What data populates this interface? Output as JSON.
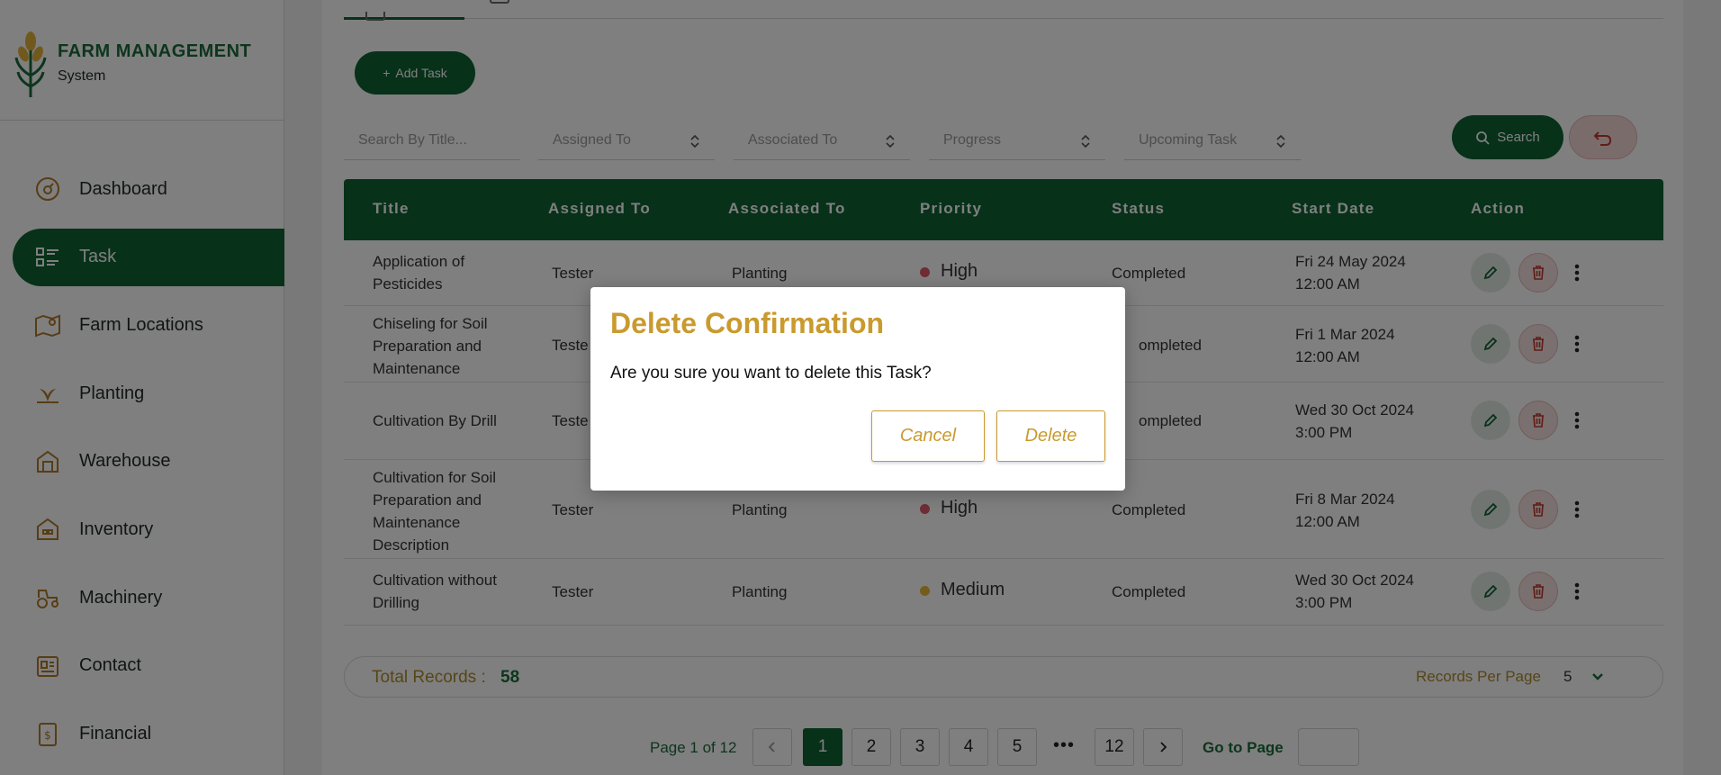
{
  "app": {
    "brand_title": "FARM MANAGEMENT",
    "brand_subtitle": "System"
  },
  "sidebar": {
    "items": [
      {
        "label": "Dashboard",
        "icon": "dashboard-gauge-icon",
        "active": false
      },
      {
        "label": "Task",
        "icon": "task-list-icon",
        "active": true
      },
      {
        "label": "Farm Locations",
        "icon": "map-pin-icon",
        "active": false
      },
      {
        "label": "Planting",
        "icon": "sprout-icon",
        "active": false
      },
      {
        "label": "Warehouse",
        "icon": "warehouse-icon",
        "active": false
      },
      {
        "label": "Inventory",
        "icon": "inventory-icon",
        "active": false
      },
      {
        "label": "Machinery",
        "icon": "tractor-icon",
        "active": false
      },
      {
        "label": "Contact",
        "icon": "contact-card-icon",
        "active": false
      },
      {
        "label": "Financial",
        "icon": "financial-document-icon",
        "active": false
      }
    ]
  },
  "toolbar": {
    "add_label": "Add Task",
    "search_label": "Search"
  },
  "filters": {
    "title_placeholder": "Search By Title...",
    "assigned_to": "Assigned To",
    "associated_to": "Associated To",
    "progress": "Progress",
    "upcoming": "Upcoming Task"
  },
  "table": {
    "headers": [
      "Title",
      "Assigned To",
      "Associated To",
      "Priority",
      "Status",
      "Start Date",
      "Action"
    ],
    "rows": [
      {
        "title": "Application of Pesticides",
        "assigned": "Tester",
        "associated": "Planting",
        "priority": "High",
        "status": "Completed",
        "start": "Fri 24 May 2024 12:00 AM"
      },
      {
        "title": "Chiseling for Soil Preparation and Maintenance",
        "assigned": "Teste",
        "associated": "",
        "priority": "",
        "status": "ompleted",
        "start": "Fri 1 Mar 2024 12:00 AM"
      },
      {
        "title": "Cultivation By Drill",
        "assigned": "Teste",
        "associated": "",
        "priority": "",
        "status": "ompleted",
        "start": "Wed 30 Oct 2024 3:00 PM"
      },
      {
        "title": "Cultivation for Soil Preparation and Maintenance Description",
        "assigned": "Tester",
        "associated": "Planting",
        "priority": "High",
        "status": "Completed",
        "start": "Fri 8 Mar 2024 12:00 AM"
      },
      {
        "title": "Cultivation without Drilling",
        "assigned": "Tester",
        "associated": "Planting",
        "priority": "Medium",
        "status": "Completed",
        "start": "Wed 30 Oct 2024 3:00 PM"
      }
    ]
  },
  "records": {
    "total_label": "Total Records :",
    "total_count": "58",
    "per_page_label": "Records Per Page",
    "per_page_value": "5"
  },
  "pagination": {
    "info": "Page 1 of 12",
    "pages": [
      "1",
      "2",
      "3",
      "4",
      "5"
    ],
    "ellipsis": "•••",
    "last": "12",
    "goto_label": "Go to Page"
  },
  "modal": {
    "title": "Delete Confirmation",
    "message": "Are you sure you want to delete this Task?",
    "cancel_label": "Cancel",
    "delete_label": "Delete"
  },
  "colors": {
    "brand_green": "#0f6233",
    "accent_gold": "#c99a2e",
    "priority_high": "#e05a6a",
    "priority_medium": "#e8b93a"
  }
}
